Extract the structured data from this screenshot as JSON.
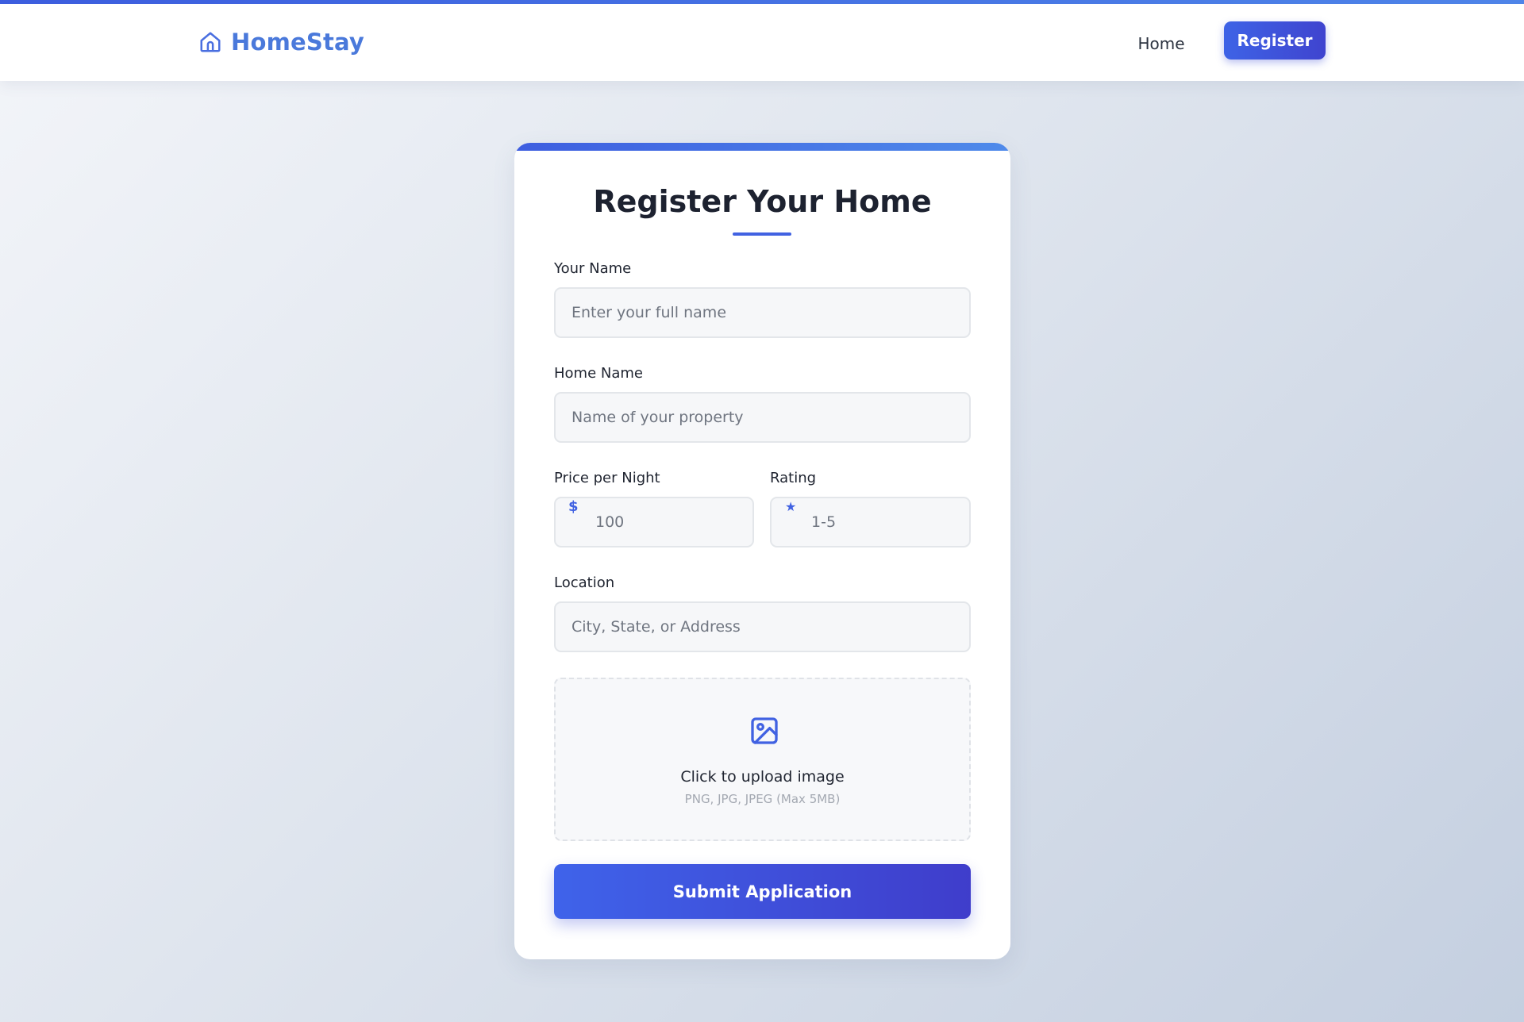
{
  "navbar": {
    "brand_name": "HomeStay",
    "brand_icon": "home-icon",
    "home_link": "Home",
    "register_button": "Register"
  },
  "form": {
    "title": "Register Your Home",
    "fields": {
      "your_name": {
        "label": "Your Name",
        "placeholder": "Enter your full name",
        "value": ""
      },
      "home_name": {
        "label": "Home Name",
        "placeholder": "Name of your property",
        "value": ""
      },
      "price": {
        "label": "Price per Night",
        "placeholder": "100",
        "icon": "$",
        "value": ""
      },
      "rating": {
        "label": "Rating",
        "placeholder": "1-5",
        "icon": "★",
        "value": ""
      },
      "location": {
        "label": "Location",
        "placeholder": "City, State, or Address",
        "value": ""
      }
    },
    "upload": {
      "icon": "image-icon",
      "title": "Click to upload image",
      "hint": "PNG, JPG, JPEG (Max 5MB)"
    },
    "submit_button": "Submit Application"
  },
  "colors": {
    "accent": "#4162e2",
    "brand": "#4a79db",
    "button_gradient_start": "#3f63ea",
    "button_gradient_end": "#3f3dcb"
  }
}
